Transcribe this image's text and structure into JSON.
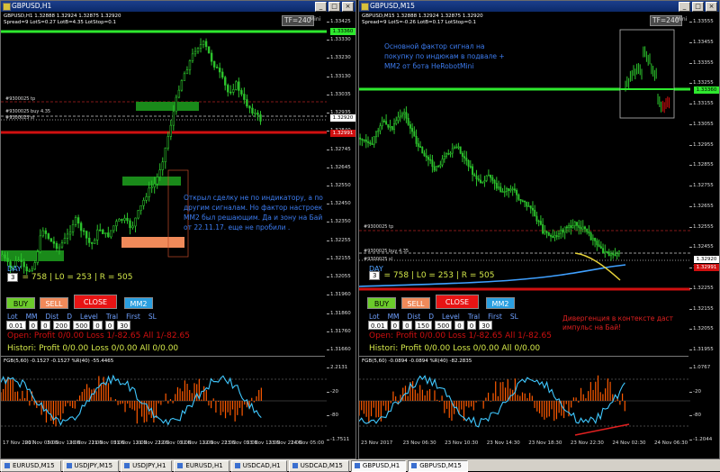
{
  "left": {
    "title": "GBPUSD,H1",
    "info1": "GBPUSD,H1  1.32888 1.32924 1.32875 1.32920",
    "info2": "Spread=9  LotS=0.27  LotB=4.35  LotStop=0.1",
    "tf": "TF=240",
    "mini": "Mini",
    "yaxis": [
      "1.33425",
      "1.33330",
      "1.33230",
      "1.33130",
      "1.33035",
      "1.32935",
      "1.32840",
      "1.32745",
      "1.32645",
      "1.32550",
      "1.32450",
      "1.32350",
      "1.32255",
      "1.32155",
      "1.32055",
      "1.31960",
      "1.31860",
      "1.31760",
      "1.31660"
    ],
    "price_green": "1.33360",
    "price_white": "1.32920",
    "price_red": "1.32991",
    "level_tp": "#9300025 tp",
    "level_buy": "#9300025 buy 4.35",
    "level_sl": "#9300025 sl",
    "comment": "Открыл сделку не по индикатору, а по другим сигналам. Но фактор настроек ММ2 был решающим. Да и зону на Бай от 22.11.17. еще не пробили .",
    "day": "DAY",
    "stat_num": "3",
    "stat": "= 758 | L0 = 253 | R = 505",
    "btn_buy": "BUY",
    "btn_sell": "SELL",
    "btn_close": "CLOSE",
    "btn_mm": "MM2",
    "labels": [
      "Lot",
      "MM",
      "Dist",
      "D",
      "Level",
      "Tral",
      "First",
      "SL"
    ],
    "values": [
      "0.01",
      "0",
      "0",
      "200",
      "500",
      "0",
      "0",
      "30"
    ],
    "open_line": "Open:   Profit 0/0.00  Loss 1/-82.65  All 1/-82.65",
    "hist_line": "Histori: Profit 0/0.00  Loss 0/0.00  All 0/0.00",
    "osc_info": "FGB(5,60) -0.1527 -0.1527  %R(40) -55.4465",
    "osc_axis": [
      "2.2131",
      "-20",
      "-80",
      "-1.7511"
    ],
    "xaxis": [
      "17 Nov 2017",
      "20 Nov 05:00",
      "20 Nov 13:00",
      "20 Nov 21:00",
      "21 Nov 05:00",
      "21 Nov 13:00",
      "21 Nov 21:00",
      "22 Nov 05:00",
      "22 Nov 13:00",
      "22 Nov 21:00",
      "23 Nov 05:00",
      "23 Nov 13:00",
      "23 Nov 21:00",
      "24 Nov 05:00"
    ],
    "colors": {
      "up": "#2cc22c",
      "down": "#d01010",
      "level_green": "#2ee82e",
      "osc_hist": "#ff5a00",
      "osc_line": "#3fc8ff"
    }
  },
  "right": {
    "title": "GBPUSD,M15",
    "info1": "GBPUSD,M15  1.32888 1.32924 1.32875 1.32920",
    "info2": "Spread=9  LotS=-0.26  LotB=0.17  LotStop=0.1",
    "tf": "TF=240",
    "mini": "Mini",
    "yaxis": [
      "1.33555",
      "1.33455",
      "1.33355",
      "1.33255",
      "1.33155",
      "1.33055",
      "1.32955",
      "1.32855",
      "1.32755",
      "1.32655",
      "1.32555",
      "1.32455",
      "1.32355",
      "1.32255",
      "1.32155",
      "1.32055",
      "1.31955"
    ],
    "price_green": "1.33360",
    "price_white": "1.32920",
    "price_red": "1.32991",
    "level_tp": "#9300025 tp",
    "level_buy": "#9300025 buy 4.35",
    "level_sl": "#9300025 sl",
    "comment": "Основной фактор сигнал на покупку по индюкам в подвале + ММ2 от бота HeRobotMini",
    "day": "DAY",
    "stat_num": "3",
    "stat": "= 758 | L0 = 253 | R = 505",
    "btn_buy": "BUY",
    "btn_sell": "SELL",
    "btn_close": "CLOSE",
    "btn_mm": "MM2",
    "labels": [
      "Lot",
      "MM",
      "Dist",
      "D",
      "Level",
      "Tral",
      "First",
      "SL"
    ],
    "values": [
      "0.01",
      "0",
      "0",
      "150",
      "500",
      "0",
      "0",
      "30"
    ],
    "open_line": "Open:   Profit 0/0.00  Loss 1/-82.65  All 1/-82.65",
    "hist_line": "Histori: Profit 0/0.00  Loss 0/0.00  All 0/0.00",
    "divergence": "Дивергенция в контексте даст импульс на Бай!",
    "osc_info": "FGB(5,60) -0.0894 -0.0894  %R(40) -82.2835",
    "osc_axis": [
      "1.0767",
      "-20",
      "-80",
      "-1.2044"
    ],
    "xaxis": [
      "23 Nov 2017",
      "23 Nov 06:30",
      "23 Nov 10:30",
      "23 Nov 14:30",
      "23 Nov 18:30",
      "23 Nov 22:30",
      "24 Nov 02:30",
      "24 Nov 06:30"
    ]
  },
  "taskbar": [
    "EURUSD,M15",
    "USDJPY,M15",
    "USDJPY,H1",
    "EURUSD,H1",
    "USDCAD,H1",
    "USDCAD,M15",
    "GBPUSD,H1",
    "GBPUSD,M15"
  ]
}
